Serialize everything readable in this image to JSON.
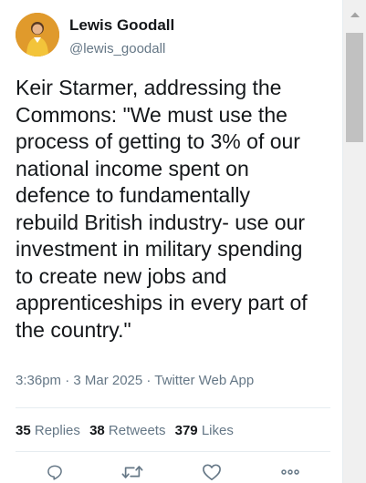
{
  "tweet": {
    "author_name": "Lewis Goodall",
    "author_handle": "@lewis_goodall",
    "text": "Keir Starmer, addressing the\nCommons: \"We must use the\nprocess of getting to 3% of our\nnational income spent on\ndefence to fundamentally\nrebuild British industry- use our\ninvestment in military spending\nto create new jobs and\napprenticeships in every part of\nthe country.\"",
    "meta": "3:36pm · 3 Mar 2025 · Twitter Web App",
    "stats": {
      "replies_count": "35",
      "replies_label": "Replies",
      "retweets_count": "38",
      "retweets_label": "Retweets",
      "likes_count": "379",
      "likes_label": "Likes"
    }
  },
  "icons": {
    "reply": "reply-icon",
    "retweet": "retweet-icon",
    "like": "heart-icon",
    "more": "more-icon"
  },
  "colors": {
    "text": "#14171a",
    "secondary": "#657786",
    "divider": "#e6ecf0",
    "scrollbar_track": "#f0f0f0",
    "scrollbar_thumb": "#c1c1c1"
  }
}
